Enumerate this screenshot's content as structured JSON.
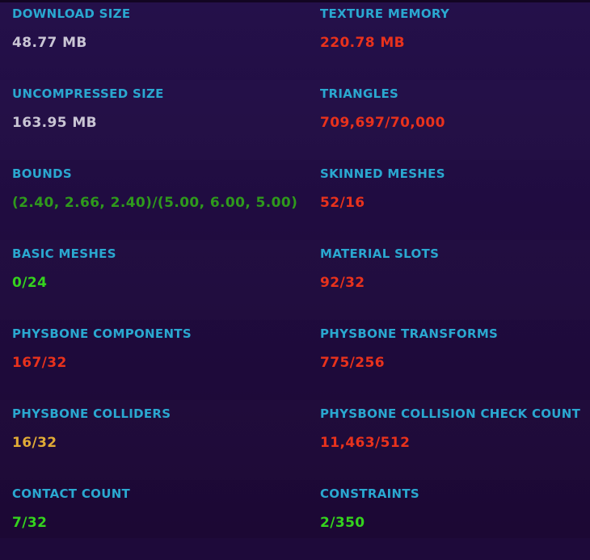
{
  "colors": {
    "background": "#200c40",
    "label": "#2aa8d0",
    "neutral": "#c9c5d4",
    "bad": "#e8321c",
    "good": "#35d21e",
    "ok": "#2f9a1c",
    "warn": "#e0ab36"
  },
  "stats": [
    {
      "label": "DOWNLOAD SIZE",
      "value": "48.77 MB",
      "status": "neutral"
    },
    {
      "label": "TEXTURE MEMORY",
      "value": "220.78 MB",
      "status": "bad"
    },
    {
      "label": "UNCOMPRESSED SIZE",
      "value": "163.95 MB",
      "status": "neutral"
    },
    {
      "label": "TRIANGLES",
      "value": "709,697/70,000",
      "status": "bad"
    },
    {
      "label": "BOUNDS",
      "value": "(2.40, 2.66, 2.40)/(5.00, 6.00, 5.00)",
      "status": "ok"
    },
    {
      "label": "SKINNED MESHES",
      "value": "52/16",
      "status": "bad"
    },
    {
      "label": "BASIC MESHES",
      "value": "0/24",
      "status": "good"
    },
    {
      "label": "MATERIAL SLOTS",
      "value": "92/32",
      "status": "bad"
    },
    {
      "label": "PHYSBONE COMPONENTS",
      "value": "167/32",
      "status": "bad"
    },
    {
      "label": "PHYSBONE TRANSFORMS",
      "value": "775/256",
      "status": "bad"
    },
    {
      "label": "PHYSBONE COLLIDERS",
      "value": "16/32",
      "status": "warn"
    },
    {
      "label": "PHYSBONE COLLISION CHECK COUNT",
      "value": "11,463/512",
      "status": "bad"
    },
    {
      "label": "CONTACT COUNT",
      "value": "7/32",
      "status": "good"
    },
    {
      "label": "CONSTRAINTS",
      "value": "2/350",
      "status": "good"
    }
  ]
}
